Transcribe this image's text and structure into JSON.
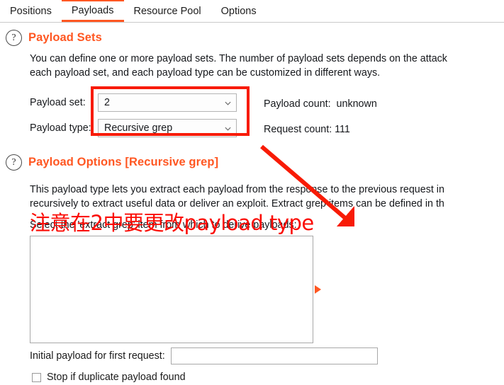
{
  "tabs": [
    {
      "label": "Positions",
      "active": false
    },
    {
      "label": "Payloads",
      "active": true
    },
    {
      "label": "Resource Pool",
      "active": false
    },
    {
      "label": "Options",
      "active": false
    }
  ],
  "payload_sets": {
    "help_icon": "question-mark-icon",
    "title": "Payload Sets",
    "description_line1": "You can define one or more payload sets. The number of payload sets depends on the attack",
    "description_line2": "each payload set, and each payload type can be customized in different ways.",
    "payload_set_label": "Payload set:",
    "payload_set_value": "2",
    "payload_type_label": "Payload type:",
    "payload_type_value": "Recursive grep",
    "payload_count_label": "Payload count:",
    "payload_count_value": "unknown",
    "request_count_label": "Request count:",
    "request_count_value": "111"
  },
  "payload_options": {
    "help_icon": "question-mark-icon",
    "title": "Payload Options [Recursive grep]",
    "description_line1": "This payload type lets you extract each payload from the response to the previous request in",
    "description_line2": "recursively to extract useful data or deliver an exploit. Extract grep items can be defined in th",
    "select_item_label": "Select the 'extract grep' item from which to derive payloads:",
    "list_items": [],
    "list_marker_icon": "play-triangle-icon",
    "initial_payload_label": "Initial payload for first request:",
    "initial_payload_value": "",
    "stop_duplicate_label": "Stop if duplicate payload found",
    "stop_duplicate_checked": false
  },
  "annotations": {
    "text": "注意在2中要更改payload type",
    "arrow_icon": "arrow-up-left-icon",
    "box_color": "#f81b05",
    "text_color": "#fb0b04"
  },
  "theme": {
    "accent": "#ff5722"
  }
}
